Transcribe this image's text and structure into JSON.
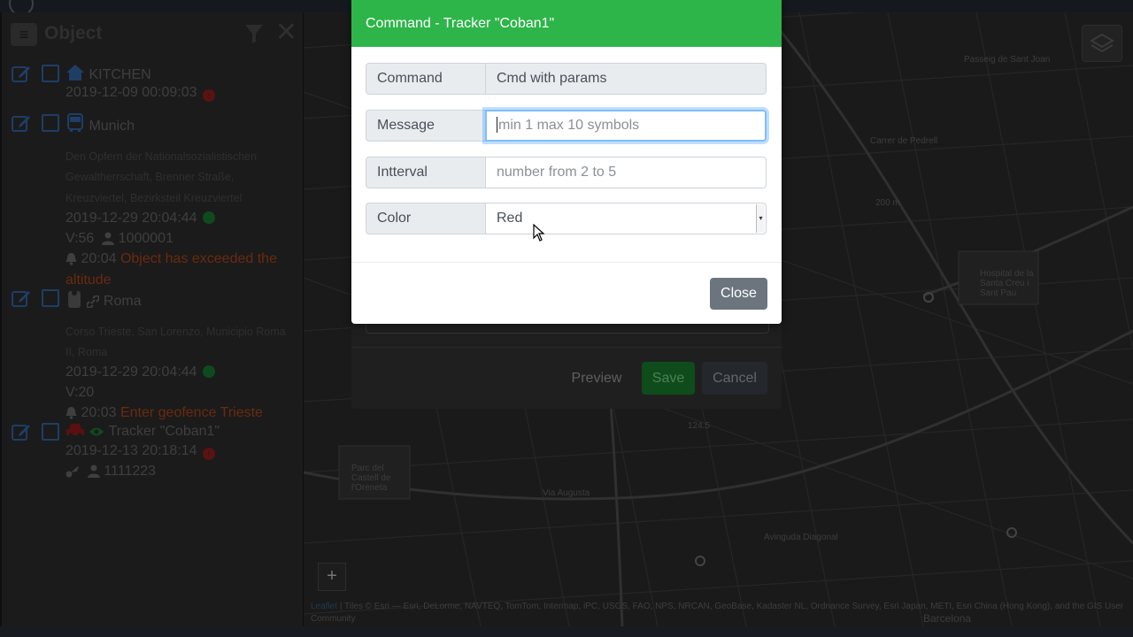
{
  "sidebar": {
    "title": "Object",
    "objects": [
      {
        "name": "KITCHEN",
        "time": "2019-12-09 00:09:03"
      },
      {
        "name": "Munich",
        "address": [
          "Den Opfern der Nationalsozialistischen",
          "Gewaltherrschaft, Brenner Straße,",
          "Kreuzviertel, Bezirksteil Kreuzviertel"
        ],
        "time": "2019-12-29 20:04:44",
        "speed": "V:56",
        "user": "1000001",
        "event_time": "20:04",
        "event_text": [
          "Object has exceeded the",
          "altitude"
        ]
      },
      {
        "name": "Roma",
        "address": [
          "Corso Trieste, San Lorenzo, Municipio Roma",
          "II, Roma"
        ],
        "time": "2019-12-29 20:04:44",
        "speed": "V:20",
        "event_time": "20:03",
        "event_text": [
          "Enter geofence Trieste"
        ]
      },
      {
        "name": "Tracker \"Coban1\"",
        "time": "2019-12-13 20:18:14",
        "user": "1111223"
      }
    ]
  },
  "map": {
    "attribution_leaflet": "Leaflet",
    "attribution_text": "| Tiles © Esri — Esri, DeLorme, NAVTEQ, TomTom, Intermap, iPC, USGS, FAO, NPS, NRCAN, GeoBase, Kadaster NL, Ordnance Survey, Esri Japan, METI, Esri China (Hong Kong), and the GIS User Community",
    "zoom_in": "+",
    "labels": {
      "via_augusta": "Via Augusta",
      "passeig": "Passeig de Sant Joan",
      "hospital": "Hospital de la Santa Creu i Sant Pau",
      "parc": "Parc del Castell de l'Oreneta",
      "diagonal": "Avinguda Diagonal",
      "carrer_pedrell": "Carrer de Pedrell",
      "distance": "200 m",
      "barcelona": "Barcelona",
      "elev": "124.5"
    }
  },
  "background_dialog": {
    "preview": "Preview",
    "save": "Save",
    "cancel": "Cancel"
  },
  "modal": {
    "title": "Command - Tracker \"Coban1\"",
    "fields": {
      "command_label": "Command",
      "command_value": "Cmd with params",
      "message_label": "Message",
      "message_placeholder": "min 1 max 10 symbols",
      "interval_label": "Intterval",
      "interval_placeholder": "number from 2 to 5",
      "color_label": "Color",
      "color_value": "Red"
    },
    "close": "Close"
  },
  "colors": {
    "header_green": "#2db549",
    "close_gray": "#6c757d",
    "focus_blue": "#80bdff"
  }
}
